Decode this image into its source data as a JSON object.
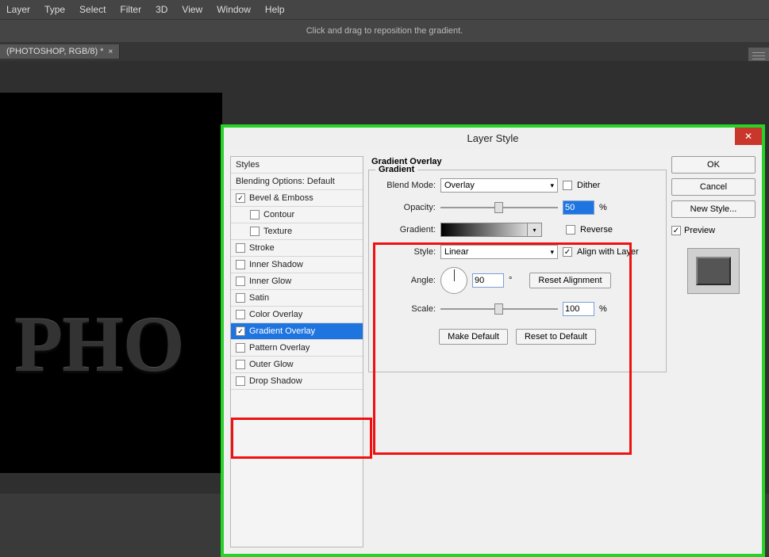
{
  "menu": [
    "Layer",
    "Type",
    "Select",
    "Filter",
    "3D",
    "View",
    "Window",
    "Help"
  ],
  "hint": "Click and drag to reposition the gradient.",
  "tab": {
    "label": "(PHOTOSHOP, RGB/8) *"
  },
  "canvas_text": "PHO",
  "dialog": {
    "title": "Layer Style",
    "styles_header": "Styles",
    "blending_header": "Blending Options: Default",
    "effects": [
      {
        "label": "Bevel & Emboss",
        "checked": true,
        "indent": false
      },
      {
        "label": "Contour",
        "checked": false,
        "indent": true
      },
      {
        "label": "Texture",
        "checked": false,
        "indent": true
      },
      {
        "label": "Stroke",
        "checked": false,
        "indent": false
      },
      {
        "label": "Inner Shadow",
        "checked": false,
        "indent": false
      },
      {
        "label": "Inner Glow",
        "checked": false,
        "indent": false
      },
      {
        "label": "Satin",
        "checked": false,
        "indent": false
      },
      {
        "label": "Color Overlay",
        "checked": false,
        "indent": false
      },
      {
        "label": "Gradient Overlay",
        "checked": true,
        "indent": false,
        "selected": true
      },
      {
        "label": "Pattern Overlay",
        "checked": false,
        "indent": false
      },
      {
        "label": "Outer Glow",
        "checked": false,
        "indent": false
      },
      {
        "label": "Drop Shadow",
        "checked": false,
        "indent": false
      }
    ],
    "section": "Gradient Overlay",
    "group": "Gradient",
    "blend_mode": {
      "label": "Blend Mode:",
      "value": "Overlay"
    },
    "dither": "Dither",
    "opacity": {
      "label": "Opacity:",
      "value": "50",
      "unit": "%"
    },
    "gradient": {
      "label": "Gradient:"
    },
    "reverse": "Reverse",
    "style": {
      "label": "Style:",
      "value": "Linear"
    },
    "align": "Align with Layer",
    "angle": {
      "label": "Angle:",
      "value": "90",
      "unit": "°"
    },
    "reset_align": "Reset Alignment",
    "scale": {
      "label": "Scale:",
      "value": "100",
      "unit": "%"
    },
    "make_default": "Make Default",
    "reset_default": "Reset to Default",
    "buttons": {
      "ok": "OK",
      "cancel": "Cancel",
      "new_style": "New Style..."
    },
    "preview": "Preview"
  }
}
